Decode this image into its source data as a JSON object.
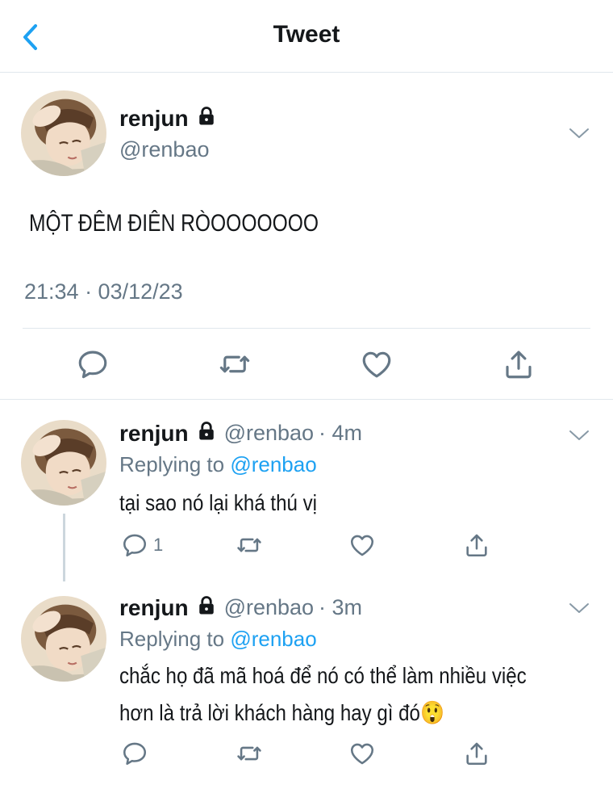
{
  "header": {
    "title": "Tweet"
  },
  "main_tweet": {
    "name": "renjun",
    "handle": "@renbao",
    "text": "MỘT ĐÊM ĐIÊN RÒOOOOOOO",
    "timestamp": "21:34 · 03/12/23"
  },
  "replies": [
    {
      "name": "renjun",
      "handle": "@renbao",
      "time": "· 4m",
      "replying_prefix": "Replying to ",
      "replying_to": "@renbao",
      "text_lines": [
        "tại sao nó lại khá thú vị"
      ],
      "reply_count": "1"
    },
    {
      "name": "renjun",
      "handle": "@renbao",
      "time": "· 3m",
      "replying_prefix": "Replying to ",
      "replying_to": "@renbao",
      "text_lines": [
        "chắc họ đã mã hoá để nó có thể làm nhiều việc",
        "hơn là trả lời khách hàng hay gì đó😲"
      ],
      "reply_count": ""
    }
  ],
  "colors": {
    "accent": "#1da1f2",
    "muted": "#657786",
    "border": "#e1e8ed"
  },
  "icons": [
    "back-chevron-icon",
    "lock-icon",
    "caret-down-icon",
    "reply-icon",
    "retweet-icon",
    "like-icon",
    "share-icon"
  ]
}
